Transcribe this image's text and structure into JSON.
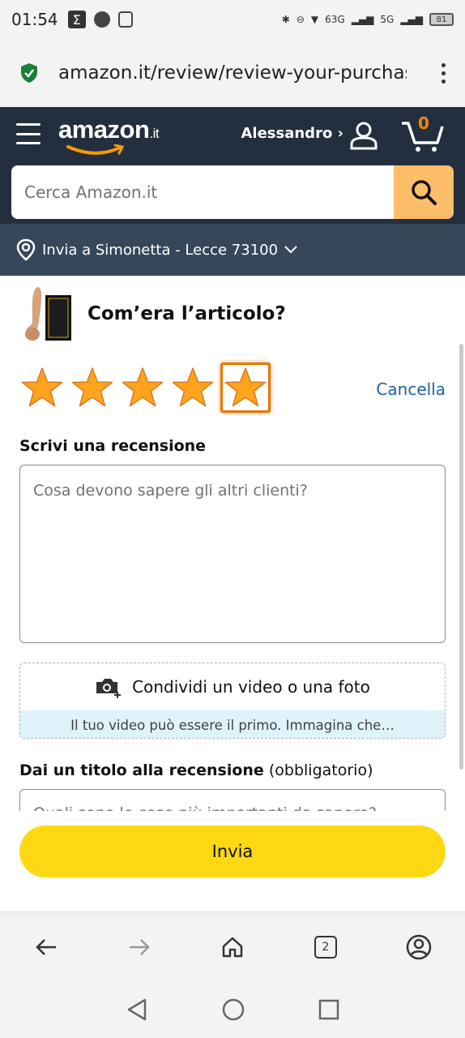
{
  "status_bar": {
    "time": "01:54",
    "network_label_1": "63G",
    "network_label_2": "5G",
    "battery": "81"
  },
  "browser": {
    "url": "amazon.it/review/review-your-purchas",
    "tab_count": "2"
  },
  "header": {
    "logo_text": "amazon",
    "logo_suffix": ".it",
    "user_label": "Alessandro ›",
    "cart_count": "0",
    "search_placeholder": "Cerca Amazon.it",
    "deliver_to": "Invia a Simonetta - Lecce 73100"
  },
  "review": {
    "question": "Com’era l’articolo?",
    "rating": 5,
    "rating_max": 5,
    "cancel_label": "Cancella",
    "write_label": "Scrivi una recensione",
    "review_placeholder": "Cosa devono sapere gli altri clienti?",
    "media_label": "Condividi un video o una foto",
    "media_sub": "Il tuo video può essere il primo. Immagina che…",
    "title_label": "Dai un titolo alla recensione",
    "title_required": "(obbligatorio)",
    "title_placeholder": "Quali sono le cose più importanti da sapere?",
    "submit_label": "Invia"
  },
  "colors": {
    "header_bg": "#232f3e",
    "deliver_bg": "#37475a",
    "star": "#ffa41c",
    "link": "#2162a1",
    "submit": "#ffd814",
    "search_btn": "#febd69"
  }
}
